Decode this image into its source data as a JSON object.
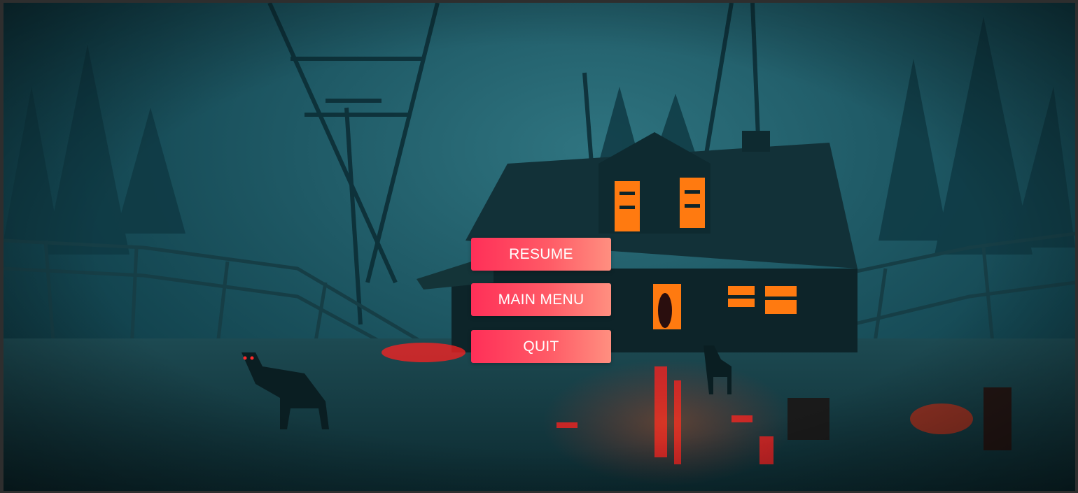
{
  "pause_menu": {
    "buttons": [
      {
        "label": "RESUME"
      },
      {
        "label": "MAIN MENU"
      },
      {
        "label": "QUIT"
      }
    ]
  },
  "colors": {
    "button_gradient_start": "#ff2f58",
    "button_gradient_end": "#ff8f80",
    "scene_fog": "#1f5a66",
    "window_glow": "#ff6a00"
  }
}
